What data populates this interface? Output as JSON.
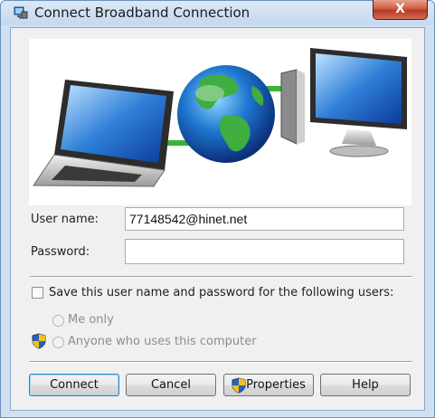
{
  "window": {
    "title": "Connect Broadband Connection",
    "close_glyph": "X"
  },
  "icons": {
    "title": "network-connection-icon",
    "close": "close-icon",
    "uac": "uac-shield-icon"
  },
  "form": {
    "username_label": "User name:",
    "username_value": "77148542@hinet.net",
    "password_label": "Password:",
    "password_value": ""
  },
  "save": {
    "label": "Save this user name and password for the following users:",
    "checked": false,
    "options": [
      {
        "label": "Me only",
        "selected": false,
        "enabled": false
      },
      {
        "label": "Anyone who uses this computer",
        "selected": false,
        "enabled": false
      }
    ]
  },
  "buttons": {
    "connect": "Connect",
    "cancel": "Cancel",
    "properties": "Properties",
    "help": "Help"
  },
  "colors": {
    "close_red": "#c8452b",
    "link_green": "#3ab33a",
    "default_button_border": "#3c7fb1"
  }
}
